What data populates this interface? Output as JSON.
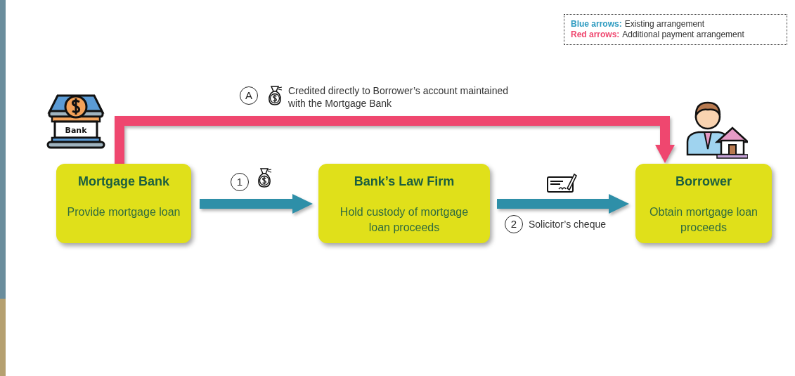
{
  "bank_sign": "Bank",
  "legend": [
    {
      "key": "Blue arrows:",
      "text": "Existing arrangement",
      "color": "#2e9bc0"
    },
    {
      "key": "Red arrows:",
      "text": "Additional payment arrangement",
      "color": "#ef476f"
    }
  ],
  "nodes": [
    {
      "title": "Mortgage Bank",
      "description": "Provide mortgage loan"
    },
    {
      "title": "Bank’s Law Firm",
      "description": "Hold custody of mortgage loan proceeds"
    },
    {
      "title": "Borrower",
      "description": "Obtain mortgage loan proceeds"
    }
  ],
  "flows": [
    {
      "marker": "A",
      "text": "Credited directly to Borrower’s account maintained with the Mortgage Bank",
      "color": "#ef476f"
    },
    {
      "marker": "1",
      "color": "#2e8fa8"
    },
    {
      "marker": "2",
      "text": "Solicitor’s cheque",
      "color": "#2e8fa8"
    }
  ]
}
